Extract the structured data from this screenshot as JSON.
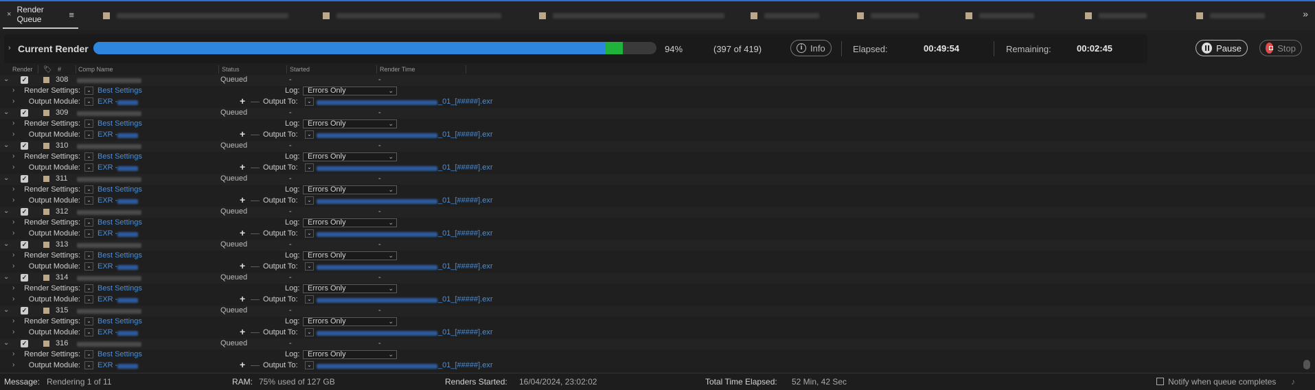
{
  "panel": {
    "title": "Render Queue",
    "close_glyph": "×",
    "menu_glyph": "≡"
  },
  "current_render": {
    "label": "Current Render",
    "progress": 0.94,
    "percent": "94%",
    "count": "(397 of 419)",
    "info_label": "Info",
    "elapsed_label": "Elapsed:",
    "elapsed_value": "00:49:54",
    "remaining_label": "Remaining:",
    "remaining_value": "00:02:45",
    "pause_label": "Pause",
    "stop_label": "Stop"
  },
  "columns": {
    "render": "Render",
    "num": "#",
    "comp_name": "Comp Name",
    "status": "Status",
    "started": "Started",
    "render_time": "Render Time"
  },
  "items": [
    {
      "num": "308",
      "status": "Queued",
      "started": "-",
      "render_time": "-"
    },
    {
      "num": "309",
      "status": "Queued",
      "started": "-",
      "render_time": "-"
    },
    {
      "num": "310",
      "status": "Queued",
      "started": "-",
      "render_time": "-"
    },
    {
      "num": "311",
      "status": "Queued",
      "started": "-",
      "render_time": "-"
    },
    {
      "num": "312",
      "status": "Queued",
      "started": "-",
      "render_time": "-"
    },
    {
      "num": "313",
      "status": "Queued",
      "started": "-",
      "render_time": "-"
    },
    {
      "num": "314",
      "status": "Queued",
      "started": "-",
      "render_time": "-"
    },
    {
      "num": "315",
      "status": "Queued",
      "started": "-",
      "render_time": "-"
    },
    {
      "num": "316",
      "status": "Queued",
      "started": "-",
      "render_time": "-"
    }
  ],
  "sub": {
    "render_settings_label": "Render Settings:",
    "render_settings_value": "Best Settings",
    "output_module_label": "Output Module:",
    "output_module_value": "EXR -",
    "log_label": "Log:",
    "log_value": "Errors Only",
    "output_to_label": "Output To:",
    "output_to_suffix": "_01_[#####].exr"
  },
  "footer": {
    "message_label": "Message:",
    "message_value": "Rendering 1 of 11",
    "ram_label": "RAM:",
    "ram_value": "75% used of 127 GB",
    "renders_started_label": "Renders Started:",
    "renders_started_value": "16/04/2024, 23:02:02",
    "total_label": "Total Time Elapsed:",
    "total_value": "52 Min, 42 Sec",
    "notify_label": "Notify when queue completes"
  },
  "colors": {
    "progress_blue": "#2f86e0",
    "progress_green": "#1fb33c",
    "link_blue": "#4c8fd9",
    "label_swatch": "#bba88a",
    "stop_red": "#e04a4a"
  }
}
